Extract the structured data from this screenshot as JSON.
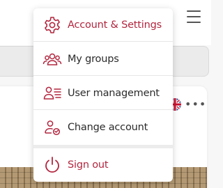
{
  "accent_color": "#b3263f",
  "menu": {
    "items": [
      {
        "label": "Account & Settings",
        "icon": "gear-icon",
        "active": true
      },
      {
        "label": "My groups",
        "icon": "group-icon"
      },
      {
        "label": "User management",
        "icon": "user-list-icon"
      },
      {
        "label": "Change account",
        "icon": "switch-user-icon"
      }
    ],
    "signout": {
      "label": "Sign out",
      "icon": "power-icon"
    }
  },
  "header": {
    "menu_icon": "hamburger-icon"
  },
  "card": {
    "flag_icon": "uk-flag-icon",
    "more_icon": "more-dots-icon",
    "more_symbol": "•••"
  }
}
